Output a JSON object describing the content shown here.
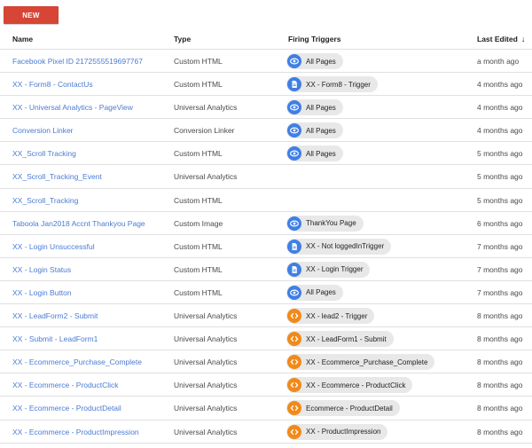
{
  "toolbar": {
    "new_label": "NEW"
  },
  "headers": {
    "name": "Name",
    "type": "Type",
    "triggers": "Firing Triggers",
    "last_edited": "Last Edited",
    "sort_icon": "arrow-down-icon"
  },
  "colors": {
    "new_button": "#d64535",
    "link": "#4a7bd4",
    "page_view_icon": "#3f7fe6",
    "custom_event_icon": "#f08a1a"
  },
  "rows": [
    {
      "name": "Facebook Pixel ID 2172555519697767",
      "type": "Custom HTML",
      "trigger": "All Pages",
      "trigger_icon": "eye-icon",
      "edited": "a month ago"
    },
    {
      "name": "XX - Form8 - ContactUs",
      "type": "Custom HTML",
      "trigger": "XX - Form8 - Trigger",
      "trigger_icon": "document-icon",
      "edited": "4 months ago"
    },
    {
      "name": "XX - Universal Analytics - PageView",
      "type": "Universal Analytics",
      "trigger": "All Pages",
      "trigger_icon": "eye-icon",
      "edited": "4 months ago"
    },
    {
      "name": "Conversion Linker",
      "type": "Conversion Linker",
      "trigger": "All Pages",
      "trigger_icon": "eye-icon",
      "edited": "4 months ago"
    },
    {
      "name": "XX_Scroll Tracking",
      "type": "Custom HTML",
      "trigger": "All Pages",
      "trigger_icon": "eye-icon",
      "edited": "5 months ago"
    },
    {
      "name": "XX_Scroll_Tracking_Event",
      "type": "Universal Analytics",
      "trigger": "",
      "trigger_icon": "",
      "edited": "5 months ago"
    },
    {
      "name": "XX_Scroll_Tracking",
      "type": "Custom HTML",
      "trigger": "",
      "trigger_icon": "",
      "edited": "5 months ago"
    },
    {
      "name": "Taboola Jan2018 Accnt Thankyou Page",
      "type": "Custom Image",
      "trigger": "ThankYou Page",
      "trigger_icon": "eye-icon",
      "edited": "6 months ago"
    },
    {
      "name": "XX - Login Unsuccessful",
      "type": "Custom HTML",
      "trigger": "XX - Not loggedInTrigger",
      "trigger_icon": "document-icon",
      "edited": "7 months ago"
    },
    {
      "name": "XX - Login Status",
      "type": "Custom HTML",
      "trigger": "XX - Login Trigger",
      "trigger_icon": "document-icon",
      "edited": "7 months ago"
    },
    {
      "name": "XX - Login Button",
      "type": "Custom HTML",
      "trigger": "All Pages",
      "trigger_icon": "eye-icon",
      "edited": "7 months ago"
    },
    {
      "name": "XX - LeadForm2 - Submit",
      "type": "Universal Analytics",
      "trigger": "XX - lead2 - Trigger",
      "trigger_icon": "code-icon",
      "edited": "8 months ago"
    },
    {
      "name": "XX - Submit - LeadForm1",
      "type": "Universal Analytics",
      "trigger": "XX - LeadForm1 - Submit",
      "trigger_icon": "code-icon",
      "edited": "8 months ago"
    },
    {
      "name": "XX - Ecommerce_Purchase_Complete",
      "type": "Universal Analytics",
      "trigger": "XX - Ecommerce_Purchase_Complete",
      "trigger_icon": "code-icon",
      "edited": "8 months ago"
    },
    {
      "name": "XX - Ecommerce - ProductClick",
      "type": "Universal Analytics",
      "trigger": "XX - Ecommerce - ProductClick",
      "trigger_icon": "code-icon",
      "edited": "8 months ago"
    },
    {
      "name": "XX - Ecommerce - ProductDetail",
      "type": "Universal Analytics",
      "trigger": "Ecommerce - ProductDetail",
      "trigger_icon": "code-icon",
      "edited": "8 months ago"
    },
    {
      "name": "XX - Ecommerce - ProductImpression",
      "type": "Universal Analytics",
      "trigger": "XX - ProductImpression",
      "trigger_icon": "code-icon",
      "edited": "8 months ago"
    }
  ]
}
